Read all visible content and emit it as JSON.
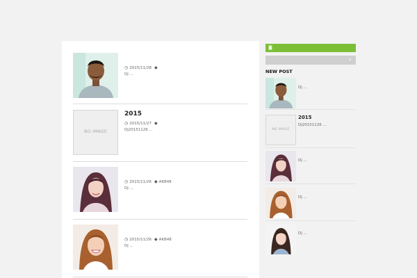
{
  "colors": {
    "background": "#f2f2f2",
    "rss_bar": "#7cbf37",
    "search_bar": "#cfcfcf"
  },
  "posts": [
    {
      "title": "",
      "date": "2015/11/28",
      "tags": "",
      "excerpt": "Dj ...",
      "image": "man-short-hair-photo"
    },
    {
      "title": "2015",
      "date": "2015/11/27",
      "tags": "",
      "excerpt": "Dj20151126 ...",
      "image": "no-image",
      "noimage_label": "NO IMAGE"
    },
    {
      "title": "",
      "date": "2015/11/26",
      "tags": "AKB48",
      "excerpt": "Dj ...",
      "image": "woman-long-hair-photo"
    },
    {
      "title": "",
      "date": "2015/11/26",
      "tags": "AKB48",
      "excerpt": "Dj  ...",
      "image": "woman-smiling-photo"
    }
  ],
  "sidebar": {
    "new_post_heading": "NEW POST",
    "items": [
      {
        "title": "",
        "text": "Dj ...",
        "image": "man-short-hair-photo"
      },
      {
        "title": "2015",
        "text": "Dj20151126 ...",
        "image": "no-image",
        "noimage_label": "NO IMAGE"
      },
      {
        "title": "",
        "text": "Dj ...",
        "image": "woman-long-hair-photo"
      },
      {
        "title": "",
        "text": "Dj  ...",
        "image": "woman-smiling-photo"
      },
      {
        "title": "",
        "text": "Dj ...",
        "image": "woman-dark-hair-photo"
      }
    ]
  },
  "icons": {
    "date": "clock-icon",
    "tag": "tag-icon",
    "rss": "rss-icon",
    "search": "search-icon"
  }
}
